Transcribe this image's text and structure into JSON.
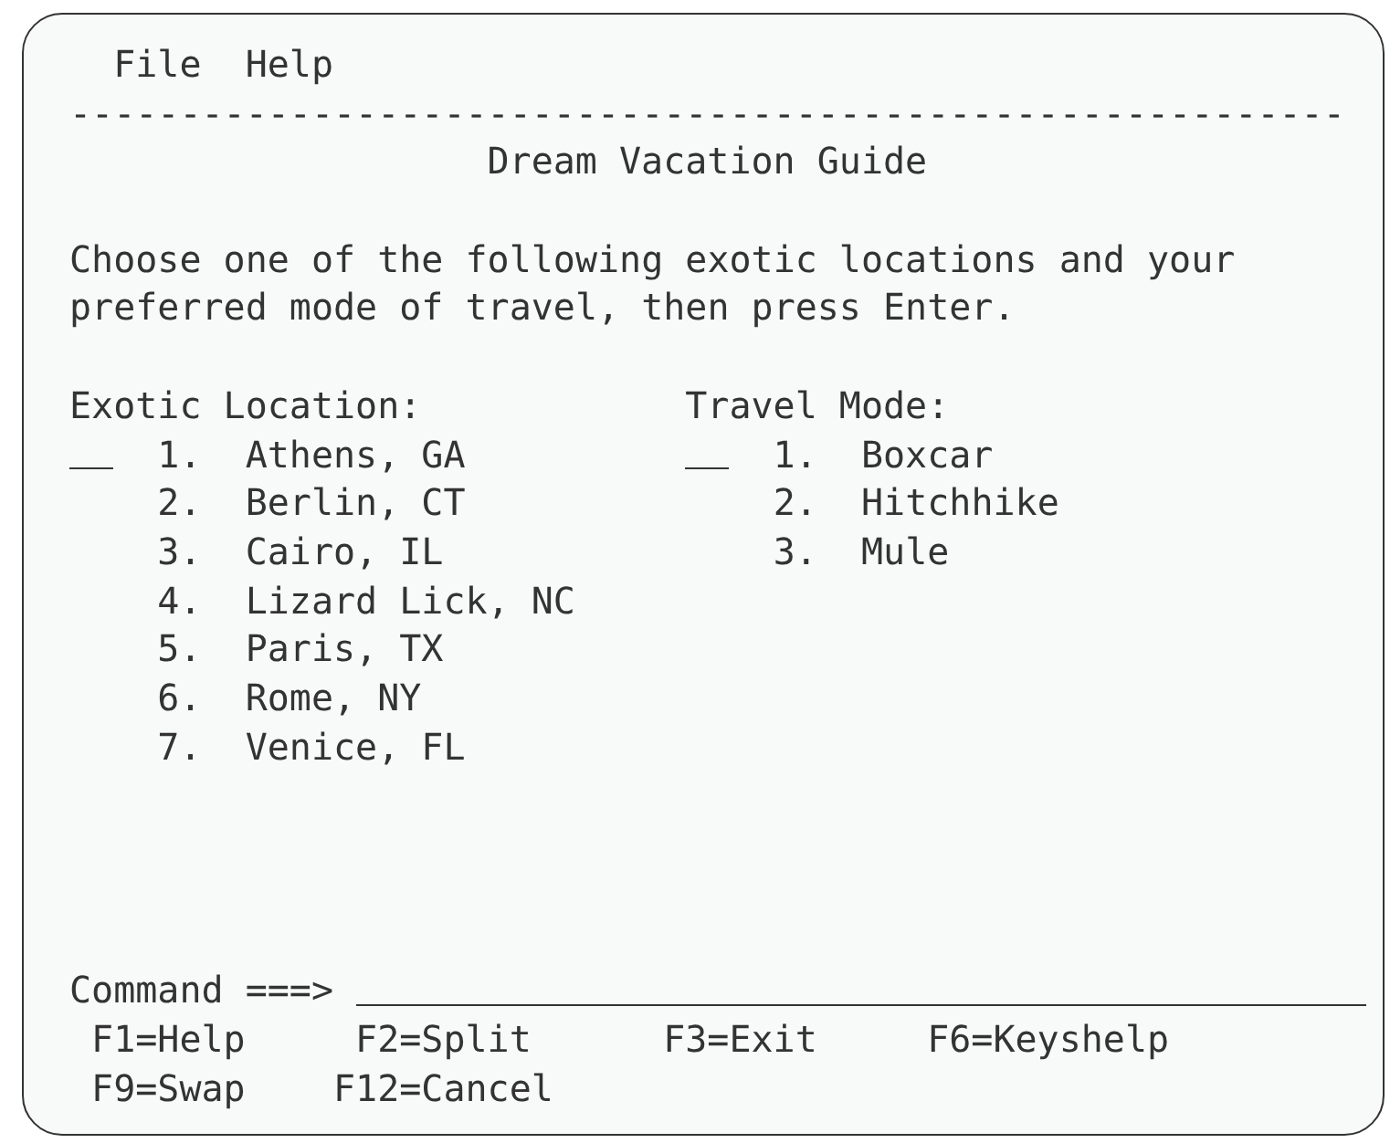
{
  "menu_bar": {
    "items": [
      "File",
      "Help"
    ],
    "separator": "----------------------------------------------------------"
  },
  "title": "Dream Vacation Guide",
  "instructions": "Choose one of the following exotic locations and your preferred mode of travel, then press Enter.",
  "lists": [
    {
      "heading": "Exotic Location:",
      "items": [
        {
          "number": "1.",
          "label": "Athens, GA"
        },
        {
          "number": "2.",
          "label": "Berlin, CT"
        },
        {
          "number": "3.",
          "label": "Cairo, IL"
        },
        {
          "number": "4.",
          "label": "Lizard Lick, NC"
        },
        {
          "number": "5.",
          "label": "Paris, TX"
        },
        {
          "number": "6.",
          "label": "Rome, NY"
        },
        {
          "number": "7.",
          "label": "Venice, FL"
        }
      ]
    },
    {
      "heading": "Travel Mode:",
      "items": [
        {
          "number": "1.",
          "label": "Boxcar"
        },
        {
          "number": "2.",
          "label": "Hitchhike"
        },
        {
          "number": "3.",
          "label": "Mule"
        }
      ]
    }
  ],
  "command": {
    "label": "Command ===>"
  },
  "function_keys": [
    [
      "F1=Help",
      "F2=Split",
      "F3=Exit",
      "F6=Keyshelp"
    ],
    [
      "F9=Swap",
      "F12=Cancel"
    ]
  ]
}
